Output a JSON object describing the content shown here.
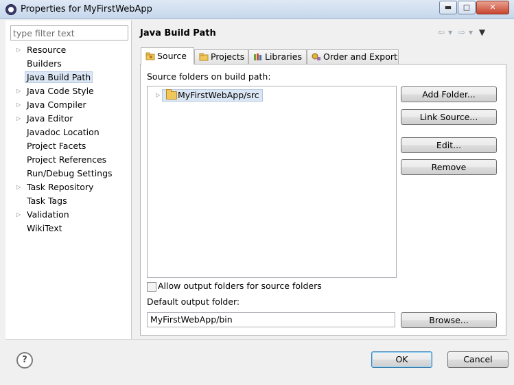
{
  "window": {
    "title": "Properties for MyFirstWebApp",
    "minimize_glyph": "▬",
    "maximize_glyph": "□",
    "close_glyph": "✕"
  },
  "sidebar": {
    "filter_placeholder": "type filter text",
    "items": [
      {
        "label": "Resource",
        "expandable": true
      },
      {
        "label": "Builders",
        "expandable": false
      },
      {
        "label": "Java Build Path",
        "expandable": false,
        "selected": true
      },
      {
        "label": "Java Code Style",
        "expandable": true
      },
      {
        "label": "Java Compiler",
        "expandable": true
      },
      {
        "label": "Java Editor",
        "expandable": true
      },
      {
        "label": "Javadoc Location",
        "expandable": false
      },
      {
        "label": "Project Facets",
        "expandable": false
      },
      {
        "label": "Project References",
        "expandable": false
      },
      {
        "label": "Run/Debug Settings",
        "expandable": false
      },
      {
        "label": "Task Repository",
        "expandable": true
      },
      {
        "label": "Task Tags",
        "expandable": false
      },
      {
        "label": "Validation",
        "expandable": true
      },
      {
        "label": "WikiText",
        "expandable": false
      }
    ]
  },
  "page": {
    "title": "Java Build Path",
    "tabs": [
      {
        "label": "Source",
        "icon": "source-folder-icon",
        "active": true
      },
      {
        "label": "Projects",
        "icon": "projects-icon"
      },
      {
        "label": "Libraries",
        "icon": "libraries-icon"
      },
      {
        "label": "Order and Export",
        "icon": "order-export-icon"
      }
    ],
    "source_label": "Source folders on build path:",
    "source_entries": [
      {
        "label": "MyFirstWebApp/src"
      }
    ],
    "buttons": {
      "add_folder": "Add Folder...",
      "link_source": "Link Source...",
      "edit": "Edit...",
      "remove": "Remove",
      "browse": "Browse..."
    },
    "allow_output_label": "Allow output folders for source folders",
    "allow_output_checked": false,
    "default_output_label": "Default output folder:",
    "default_output_value": "MyFirstWebApp/bin"
  },
  "footer": {
    "help_glyph": "?",
    "ok": "OK",
    "cancel": "Cancel"
  }
}
